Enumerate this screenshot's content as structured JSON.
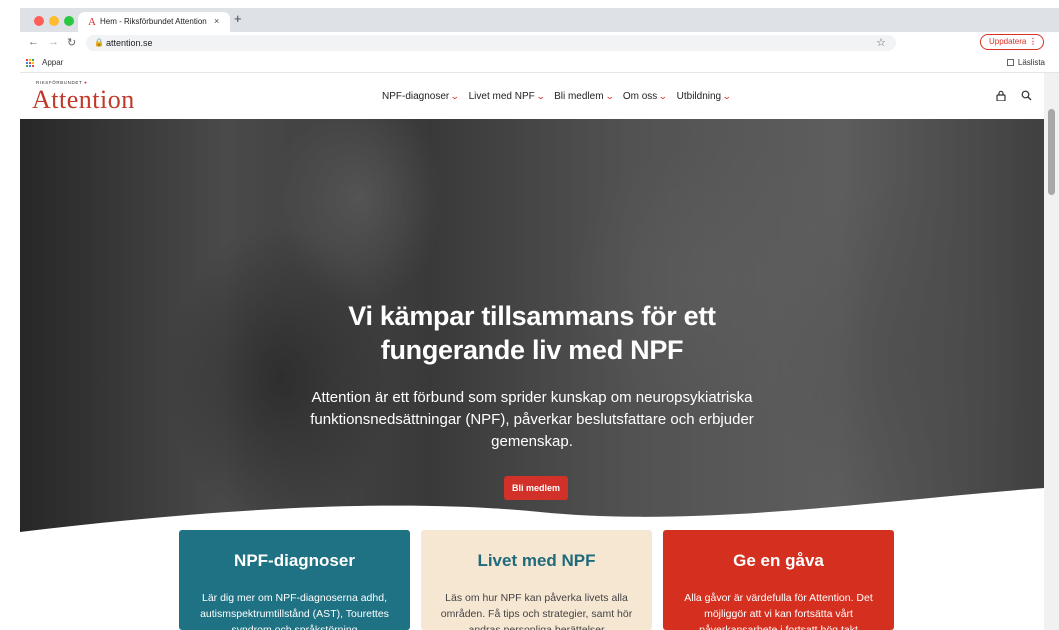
{
  "browser": {
    "tab_title": "Hem - Riksförbundet Attention",
    "tab_favicon": "A",
    "tab_close": "×",
    "new_tab": "+",
    "url": "attention.se",
    "update_label": "Uppdatera",
    "update_menu": "⋮",
    "bookmarks_apps": "Appar",
    "reading_list": "Läslista",
    "traffic_lights": [
      "#ff5f57",
      "#febc2e",
      "#28c840"
    ]
  },
  "site": {
    "logo_small_prefix": "RIKSFÖRBUNDET",
    "logo_dot": "●",
    "logo": "Attention",
    "nav": [
      {
        "label": "NPF-diagnoser"
      },
      {
        "label": "Livet med NPF"
      },
      {
        "label": "Bli medlem"
      },
      {
        "label": "Om oss"
      },
      {
        "label": "Utbildning"
      }
    ],
    "icons": [
      "lock-icon",
      "search-icon"
    ],
    "accent": "#d2312a"
  },
  "hero": {
    "title": "Vi kämpar tillsammans för ett fungerande liv med NPF",
    "text": "Attention är ett förbund som sprider kunskap om neuropsykiatriska funktionsnedsättningar (NPF), påverkar beslutsfattare och erbjuder gemenskap.",
    "cta": "Bli medlem"
  },
  "cards": [
    {
      "title": "NPF-diagnoser",
      "text": "Lär dig mer om NPF-diagnoserna adhd, autismspektrumtillstånd (AST), Tourettes syndrom och språkstörning",
      "color": "#1f7284"
    },
    {
      "title": "Livet med NPF",
      "text": "Läs om hur NPF kan påverka livets alla områden. Få tips och strategier, samt hör andras personliga berättelser",
      "color": "#f6e7d3"
    },
    {
      "title": "Ge en gåva",
      "text": "Alla gåvor är värdefulla för Attention. Det möjliggör att vi kan fortsätta vårt påverkansarbete i fortsatt hög takt",
      "color": "#d52f1f"
    }
  ]
}
